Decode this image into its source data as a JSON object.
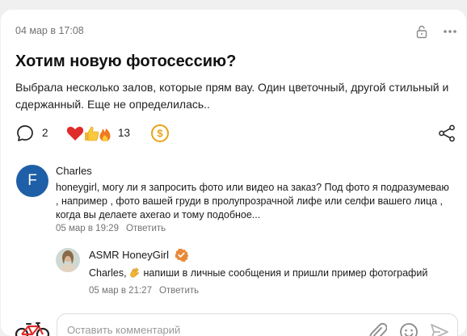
{
  "post": {
    "date": "04 мар в 17:08",
    "title": "Хотим новую фотосессию?",
    "body": "Выбрала несколько залов, которые прям вау. Один цветочный, другой стильный  и сдержанный. Еще не определилась..",
    "comment_count": "2",
    "reaction_count": "13",
    "reaction_icons": [
      "heart-icon",
      "thumbs-up-icon",
      "fire-icon"
    ]
  },
  "comments": [
    {
      "author": "Charles",
      "avatar_letter": "F",
      "avatar_color": "#1f5fa8",
      "text": "honeygirl, могу ли я запросить фото или видео на заказ? Под фото я подразумеваю , например , фото вашей груди в пролупрозрачной лифе или селфи вашего лица , когда вы делаете ахегао и тому подобное...",
      "date": "05 мар в 19:29",
      "reply_label": "Ответить"
    },
    {
      "author": "ASMR HoneyGirl",
      "verified": true,
      "text_before": "Charles, ",
      "text_after": " напиши в личные сообщения и пришли пример фотографий",
      "emoji": "clapping-hands-icon",
      "date": "05 мар в 21:27",
      "reply_label": "Ответить"
    }
  ],
  "composer": {
    "placeholder": "Оставить комментарий"
  },
  "colors": {
    "accent_orange": "#e8893a",
    "coin": "#e8a317",
    "meta_gray": "#737373"
  }
}
